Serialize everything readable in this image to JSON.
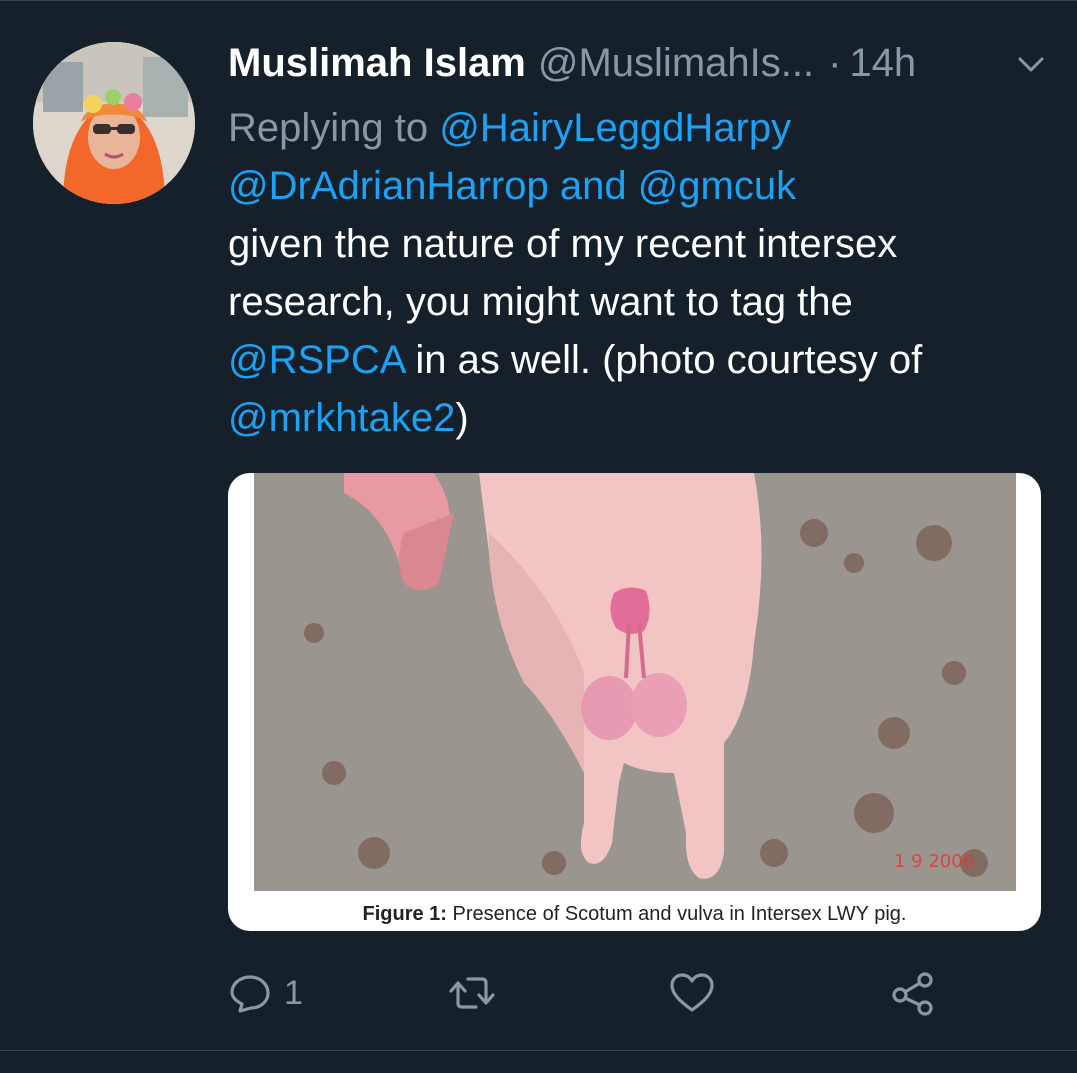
{
  "tweet": {
    "author_name": "Muslimah Islam",
    "author_handle": "@MuslimahIs...",
    "separator": "·",
    "timestamp": "14h",
    "replying_prefix": "Replying to",
    "reply_handle_1": "@HairyLeggdHarpy",
    "reply_handle_2": "@DrAdrianHarrop",
    "reply_and": "and",
    "reply_handle_3": "@gmcuk",
    "text_part_1": "given the nature of my recent intersex research, you might want to tag the",
    "mention_1": "@RSPCA",
    "text_part_2": "in as well. (photo courtesy of",
    "mention_2": "@mrkhtake2",
    "text_part_3": ")"
  },
  "media": {
    "caption_label": "Figure 1:",
    "caption_text": "Presence of Scotum and vulva in Intersex LWY pig.",
    "photo_date_stamp": "1  9 2006"
  },
  "actions": {
    "reply_count": "1",
    "retweet_count": "",
    "like_count": ""
  },
  "colors": {
    "background": "#15202b",
    "link": "#1da1f2",
    "muted": "#8899a6",
    "text": "#ffffff"
  },
  "icons": [
    "chevron-down-icon",
    "reply-icon",
    "retweet-icon",
    "like-icon",
    "share-icon"
  ]
}
